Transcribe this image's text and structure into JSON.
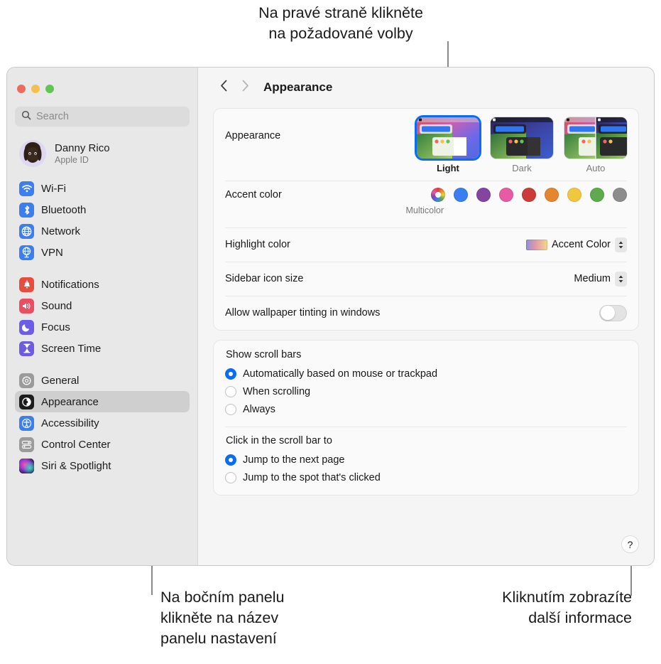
{
  "callouts": {
    "top": "Na pravé straně klikněte\nna požadované volby",
    "left": "Na bočním panelu\nklikněte na název\npanelu nastavení",
    "right": "Kliknutím zobrazíte\ndalší informace"
  },
  "window": {
    "traffic_lights": [
      "close-red",
      "minimize-yellow",
      "zoom-green"
    ]
  },
  "sidebar": {
    "search": {
      "placeholder": "Search",
      "value": ""
    },
    "account": {
      "name": "Danny Rico",
      "subtitle": "Apple ID"
    },
    "groups": [
      {
        "items": [
          {
            "label": "Wi-Fi",
            "icon": "wifi-icon",
            "color": "#3b7ef0",
            "selected": false
          },
          {
            "label": "Bluetooth",
            "icon": "bluetooth-icon",
            "color": "#3b7ef0",
            "selected": false
          },
          {
            "label": "Network",
            "icon": "network-globe-icon",
            "color": "#3b7ef0",
            "selected": false
          },
          {
            "label": "VPN",
            "icon": "vpn-icon",
            "color": "#3b7ef0",
            "selected": false
          }
        ]
      },
      {
        "items": [
          {
            "label": "Notifications",
            "icon": "bell-icon",
            "color": "#e74c3c",
            "selected": false
          },
          {
            "label": "Sound",
            "icon": "speaker-icon",
            "color": "#eb4d63",
            "selected": false
          },
          {
            "label": "Focus",
            "icon": "moon-icon",
            "color": "#6c5ce7",
            "selected": false
          },
          {
            "label": "Screen Time",
            "icon": "hourglass-icon",
            "color": "#6b5ce0",
            "selected": false
          }
        ]
      },
      {
        "items": [
          {
            "label": "General",
            "icon": "gear-icon",
            "color": "#9b9b9b",
            "selected": false
          },
          {
            "label": "Appearance",
            "icon": "appearance-contrast-icon",
            "color": "#1c1c1c",
            "selected": true
          },
          {
            "label": "Accessibility",
            "icon": "accessibility-icon",
            "color": "#3b7ef0",
            "selected": false
          },
          {
            "label": "Control Center",
            "icon": "control-center-icon",
            "color": "#9b9b9b",
            "selected": false
          },
          {
            "label": "Siri & Spotlight",
            "icon": "siri-icon",
            "color": "#2b2b4f",
            "selected": false
          }
        ]
      }
    ]
  },
  "toolbar": {
    "back_icon": "chevron-left-icon",
    "forward_icon": "chevron-right-icon",
    "title": "Appearance"
  },
  "main": {
    "appearance": {
      "label": "Appearance",
      "options": [
        {
          "caption": "Light",
          "selected": true
        },
        {
          "caption": "Dark",
          "selected": false
        },
        {
          "caption": "Auto",
          "selected": false
        }
      ]
    },
    "accent_color": {
      "label": "Accent color",
      "selected_name": "Multicolor",
      "swatches": [
        {
          "name": "Multicolor",
          "color": "multicolor",
          "selected": true
        },
        {
          "name": "Blue",
          "color": "#3b7ef0",
          "selected": false
        },
        {
          "name": "Purple",
          "color": "#8445a0",
          "selected": false
        },
        {
          "name": "Pink",
          "color": "#e85aa4",
          "selected": false
        },
        {
          "name": "Red",
          "color": "#cb3b39",
          "selected": false
        },
        {
          "name": "Orange",
          "color": "#e5852e",
          "selected": false
        },
        {
          "name": "Yellow",
          "color": "#f2c740",
          "selected": false
        },
        {
          "name": "Green",
          "color": "#5dab4c",
          "selected": false
        },
        {
          "name": "Graphite",
          "color": "#8d8d8d",
          "selected": false
        }
      ]
    },
    "highlight_color": {
      "label": "Highlight color",
      "value": "Accent Color"
    },
    "sidebar_icon_size": {
      "label": "Sidebar icon size",
      "value": "Medium"
    },
    "wallpaper_tinting": {
      "label": "Allow wallpaper tinting in windows",
      "enabled": false
    },
    "show_scroll_bars": {
      "title": "Show scroll bars",
      "options": [
        {
          "label": "Automatically based on mouse or trackpad",
          "selected": true
        },
        {
          "label": "When scrolling",
          "selected": false
        },
        {
          "label": "Always",
          "selected": false
        }
      ]
    },
    "click_scroll_bar": {
      "title": "Click in the scroll bar to",
      "options": [
        {
          "label": "Jump to the next page",
          "selected": true
        },
        {
          "label": "Jump to the spot that's clicked",
          "selected": false
        }
      ]
    },
    "help_button": {
      "label": "?"
    }
  },
  "colors": {
    "accent": "#0a6cf5",
    "sidebar_bg": "#e8e8e8",
    "content_bg": "#f5f5f5",
    "card_bg": "#fafafa"
  }
}
